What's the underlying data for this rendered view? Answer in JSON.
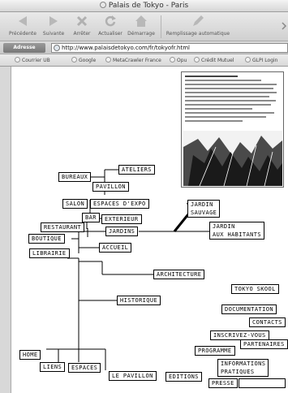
{
  "window": {
    "title": "Palais de Tokyo - Paris"
  },
  "toolbar": {
    "back_label": "Précédente",
    "forward_label": "Suivante",
    "stop_label": "Arrêter",
    "refresh_label": "Actualiser",
    "home_label": "Démarrage",
    "autofill_label": "Remplissage automatique"
  },
  "address": {
    "label": "Adresse",
    "url": "http://www.palaisdetokyo.com/fr/tokyofr.html"
  },
  "favorites": [
    "Courrier UB",
    "Google",
    "MetaCrawler France",
    "Opu",
    "Crédit Mutuel",
    "GLPI Login"
  ],
  "nav": {
    "ateliers": "ATELIERS",
    "bureaux": "BUREAUX",
    "pavillon": "PAVILLON",
    "salon": "SALON",
    "espaces_expo": "ESPACES D'EXPO",
    "bar": "BAR",
    "exterieur": "EXTERIEUR",
    "restaurant": "RESTAURANT",
    "jardins": "JARDINS",
    "boutique": "BOUTIQUE",
    "accueil": "ACCUEIL",
    "librairie": "LIBRAIRIE",
    "jardin_sauvage": [
      "JARDIN",
      "SAUVAGE"
    ],
    "jardin_habitants": [
      "JARDIN",
      "AUX HABITANTS"
    ],
    "architecture": "ARCHITECTURE",
    "historique": "HISTORIQUE",
    "tokyo_skool": "TOKYO SKOOL",
    "documentation": "DOCUMENTATION",
    "contacts": "CONTACTS",
    "inscrivez_vous": "INSCRIVEZ-VOUS",
    "partenaires": "PARTENAIRES",
    "programme": "PROGRAMME",
    "informations_pratiques": [
      "INFORMATIONS",
      "PRATIQUES"
    ],
    "home": "HOME",
    "liens": "LIENS",
    "espaces": "ESPACES",
    "le_pavillon": "LE PAVILLON",
    "editions": "EDITIONS",
    "presse": "PRESSE"
  },
  "colors": {
    "chrome_bg": "#d6d6d6",
    "line": "#000000",
    "page_bg": "#ffffff"
  }
}
